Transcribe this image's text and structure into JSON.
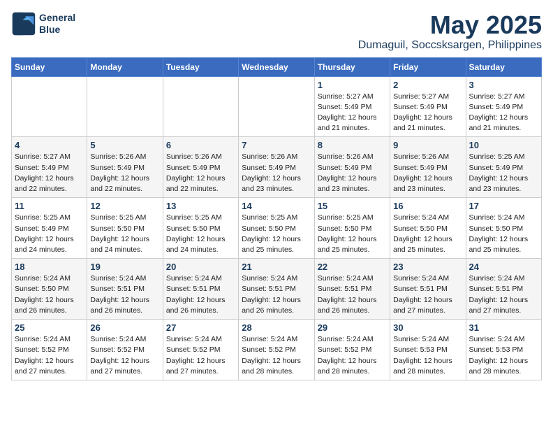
{
  "header": {
    "logo_line1": "General",
    "logo_line2": "Blue",
    "month_year": "May 2025",
    "location": "Dumaguil, Soccsksargen, Philippines"
  },
  "weekdays": [
    "Sunday",
    "Monday",
    "Tuesday",
    "Wednesday",
    "Thursday",
    "Friday",
    "Saturday"
  ],
  "weeks": [
    [
      {
        "day": "",
        "info": ""
      },
      {
        "day": "",
        "info": ""
      },
      {
        "day": "",
        "info": ""
      },
      {
        "day": "",
        "info": ""
      },
      {
        "day": "1",
        "info": "Sunrise: 5:27 AM\nSunset: 5:49 PM\nDaylight: 12 hours\nand 21 minutes."
      },
      {
        "day": "2",
        "info": "Sunrise: 5:27 AM\nSunset: 5:49 PM\nDaylight: 12 hours\nand 21 minutes."
      },
      {
        "day": "3",
        "info": "Sunrise: 5:27 AM\nSunset: 5:49 PM\nDaylight: 12 hours\nand 21 minutes."
      }
    ],
    [
      {
        "day": "4",
        "info": "Sunrise: 5:27 AM\nSunset: 5:49 PM\nDaylight: 12 hours\nand 22 minutes."
      },
      {
        "day": "5",
        "info": "Sunrise: 5:26 AM\nSunset: 5:49 PM\nDaylight: 12 hours\nand 22 minutes."
      },
      {
        "day": "6",
        "info": "Sunrise: 5:26 AM\nSunset: 5:49 PM\nDaylight: 12 hours\nand 22 minutes."
      },
      {
        "day": "7",
        "info": "Sunrise: 5:26 AM\nSunset: 5:49 PM\nDaylight: 12 hours\nand 23 minutes."
      },
      {
        "day": "8",
        "info": "Sunrise: 5:26 AM\nSunset: 5:49 PM\nDaylight: 12 hours\nand 23 minutes."
      },
      {
        "day": "9",
        "info": "Sunrise: 5:26 AM\nSunset: 5:49 PM\nDaylight: 12 hours\nand 23 minutes."
      },
      {
        "day": "10",
        "info": "Sunrise: 5:25 AM\nSunset: 5:49 PM\nDaylight: 12 hours\nand 23 minutes."
      }
    ],
    [
      {
        "day": "11",
        "info": "Sunrise: 5:25 AM\nSunset: 5:49 PM\nDaylight: 12 hours\nand 24 minutes."
      },
      {
        "day": "12",
        "info": "Sunrise: 5:25 AM\nSunset: 5:50 PM\nDaylight: 12 hours\nand 24 minutes."
      },
      {
        "day": "13",
        "info": "Sunrise: 5:25 AM\nSunset: 5:50 PM\nDaylight: 12 hours\nand 24 minutes."
      },
      {
        "day": "14",
        "info": "Sunrise: 5:25 AM\nSunset: 5:50 PM\nDaylight: 12 hours\nand 25 minutes."
      },
      {
        "day": "15",
        "info": "Sunrise: 5:25 AM\nSunset: 5:50 PM\nDaylight: 12 hours\nand 25 minutes."
      },
      {
        "day": "16",
        "info": "Sunrise: 5:24 AM\nSunset: 5:50 PM\nDaylight: 12 hours\nand 25 minutes."
      },
      {
        "day": "17",
        "info": "Sunrise: 5:24 AM\nSunset: 5:50 PM\nDaylight: 12 hours\nand 25 minutes."
      }
    ],
    [
      {
        "day": "18",
        "info": "Sunrise: 5:24 AM\nSunset: 5:50 PM\nDaylight: 12 hours\nand 26 minutes."
      },
      {
        "day": "19",
        "info": "Sunrise: 5:24 AM\nSunset: 5:51 PM\nDaylight: 12 hours\nand 26 minutes."
      },
      {
        "day": "20",
        "info": "Sunrise: 5:24 AM\nSunset: 5:51 PM\nDaylight: 12 hours\nand 26 minutes."
      },
      {
        "day": "21",
        "info": "Sunrise: 5:24 AM\nSunset: 5:51 PM\nDaylight: 12 hours\nand 26 minutes."
      },
      {
        "day": "22",
        "info": "Sunrise: 5:24 AM\nSunset: 5:51 PM\nDaylight: 12 hours\nand 26 minutes."
      },
      {
        "day": "23",
        "info": "Sunrise: 5:24 AM\nSunset: 5:51 PM\nDaylight: 12 hours\nand 27 minutes."
      },
      {
        "day": "24",
        "info": "Sunrise: 5:24 AM\nSunset: 5:51 PM\nDaylight: 12 hours\nand 27 minutes."
      }
    ],
    [
      {
        "day": "25",
        "info": "Sunrise: 5:24 AM\nSunset: 5:52 PM\nDaylight: 12 hours\nand 27 minutes."
      },
      {
        "day": "26",
        "info": "Sunrise: 5:24 AM\nSunset: 5:52 PM\nDaylight: 12 hours\nand 27 minutes."
      },
      {
        "day": "27",
        "info": "Sunrise: 5:24 AM\nSunset: 5:52 PM\nDaylight: 12 hours\nand 27 minutes."
      },
      {
        "day": "28",
        "info": "Sunrise: 5:24 AM\nSunset: 5:52 PM\nDaylight: 12 hours\nand 28 minutes."
      },
      {
        "day": "29",
        "info": "Sunrise: 5:24 AM\nSunset: 5:52 PM\nDaylight: 12 hours\nand 28 minutes."
      },
      {
        "day": "30",
        "info": "Sunrise: 5:24 AM\nSunset: 5:53 PM\nDaylight: 12 hours\nand 28 minutes."
      },
      {
        "day": "31",
        "info": "Sunrise: 5:24 AM\nSunset: 5:53 PM\nDaylight: 12 hours\nand 28 minutes."
      }
    ]
  ]
}
